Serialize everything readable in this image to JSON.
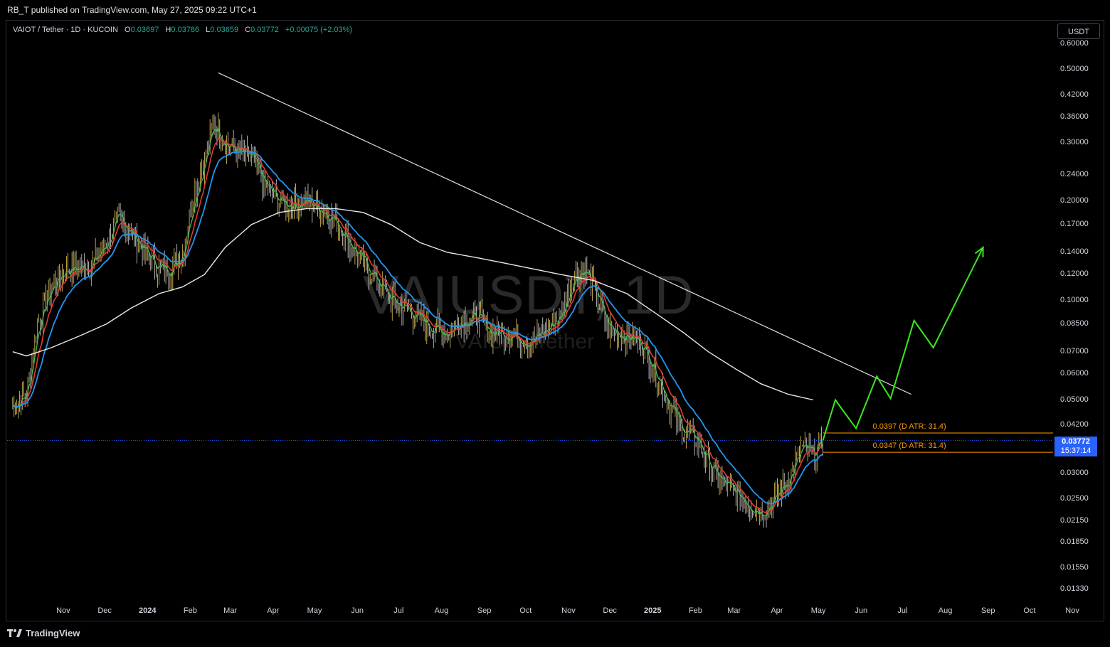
{
  "header": {
    "publish_text": "RB_T published on TradingView.com, May 27, 2025 09:22 UTC+1"
  },
  "legend": {
    "symbol": "VAIOT / Tether · 1D · KUCOIN",
    "o_label": "O",
    "o_value": "0.03697",
    "h_label": "H",
    "h_value": "0.03786",
    "l_label": "L",
    "l_value": "0.03659",
    "c_label": "C",
    "c_value": "0.03772",
    "change": "+0.00075 (+2.03%)"
  },
  "currency_button": "USDT",
  "watermark": {
    "main": "VAIUSDT, 1D",
    "sub": "VAIOT / Tether"
  },
  "price_tag": {
    "price": "0.03772",
    "countdown": "15:37:14"
  },
  "atr_levels": [
    {
      "text": "0.0397 (D ATR: 31.4)",
      "price": 0.0397
    },
    {
      "text": "0.0347 (D ATR: 31.4)",
      "price": 0.0347
    }
  ],
  "footer": {
    "brand": "TradingView"
  },
  "colors": {
    "ema_fast": "#4caf50",
    "ema_mid": "#e53935",
    "ema_slow": "#2196f3",
    "ma_long": "#e8e8e8",
    "projection": "#39e81c",
    "trendline": "#e0e0e0",
    "price_tag": "#2962ff",
    "atr": "#ff9800"
  },
  "chart_data": {
    "type": "line",
    "title": "VAIUSDT, 1D",
    "scale": "log",
    "ylim": [
      0.0125,
      0.62
    ],
    "y_ticks": [
      "0.60000",
      "0.50000",
      "0.42000",
      "0.36000",
      "0.30000",
      "0.24000",
      "0.20000",
      "0.17000",
      "0.14000",
      "0.12000",
      "0.10000",
      "0.08500",
      "0.07000",
      "0.06000",
      "0.05000",
      "0.04200",
      "0.03000",
      "0.02500",
      "0.02150",
      "0.01850",
      "0.01550",
      "0.01330"
    ],
    "x_ticks": [
      {
        "label": "Nov",
        "bold": false
      },
      {
        "label": "Dec",
        "bold": false
      },
      {
        "label": "2024",
        "bold": true
      },
      {
        "label": "Feb",
        "bold": false
      },
      {
        "label": "Mar",
        "bold": false
      },
      {
        "label": "Apr",
        "bold": false
      },
      {
        "label": "May",
        "bold": false
      },
      {
        "label": "Jun",
        "bold": false
      },
      {
        "label": "Jul",
        "bold": false
      },
      {
        "label": "Aug",
        "bold": false
      },
      {
        "label": "Sep",
        "bold": false
      },
      {
        "label": "Oct",
        "bold": false
      },
      {
        "label": "Nov",
        "bold": false
      },
      {
        "label": "Dec",
        "bold": false
      },
      {
        "label": "2025",
        "bold": true
      },
      {
        "label": "Feb",
        "bold": false
      },
      {
        "label": "Mar",
        "bold": false
      },
      {
        "label": "Apr",
        "bold": false
      },
      {
        "label": "May",
        "bold": false
      },
      {
        "label": "Jun",
        "bold": false
      },
      {
        "label": "Jul",
        "bold": false
      },
      {
        "label": "Aug",
        "bold": false
      },
      {
        "label": "Sep",
        "bold": false
      },
      {
        "label": "Oct",
        "bold": false
      },
      {
        "label": "Nov",
        "bold": false
      }
    ],
    "price_path": [
      [
        "2023-10-18",
        0.048
      ],
      [
        "2023-10-28",
        0.052
      ],
      [
        "2023-11-05",
        0.085
      ],
      [
        "2023-11-15",
        0.11
      ],
      [
        "2023-11-25",
        0.125
      ],
      [
        "2023-12-05",
        0.125
      ],
      [
        "2023-12-15",
        0.13
      ],
      [
        "2023-12-25",
        0.15
      ],
      [
        "2024-01-03",
        0.18
      ],
      [
        "2024-01-12",
        0.16
      ],
      [
        "2024-01-22",
        0.14
      ],
      [
        "2024-02-01",
        0.125
      ],
      [
        "2024-02-10",
        0.125
      ],
      [
        "2024-02-18",
        0.14
      ],
      [
        "2024-02-25",
        0.2
      ],
      [
        "2024-03-05",
        0.27
      ],
      [
        "2024-03-12",
        0.35
      ],
      [
        "2024-03-20",
        0.3
      ],
      [
        "2024-03-30",
        0.28
      ],
      [
        "2024-04-08",
        0.27
      ],
      [
        "2024-04-18",
        0.22
      ],
      [
        "2024-04-28",
        0.2
      ],
      [
        "2024-05-08",
        0.195
      ],
      [
        "2024-05-18",
        0.2
      ],
      [
        "2024-05-28",
        0.19
      ],
      [
        "2024-06-08",
        0.175
      ],
      [
        "2024-06-18",
        0.15
      ],
      [
        "2024-06-28",
        0.13
      ],
      [
        "2024-07-08",
        0.115
      ],
      [
        "2024-07-18",
        0.1
      ],
      [
        "2024-07-28",
        0.095
      ],
      [
        "2024-08-08",
        0.088
      ],
      [
        "2024-08-18",
        0.082
      ],
      [
        "2024-08-28",
        0.08
      ],
      [
        "2024-09-08",
        0.088
      ],
      [
        "2024-09-18",
        0.09
      ],
      [
        "2024-09-28",
        0.08
      ],
      [
        "2024-10-08",
        0.08
      ],
      [
        "2024-10-18",
        0.078
      ],
      [
        "2024-10-28",
        0.075
      ],
      [
        "2024-11-08",
        0.082
      ],
      [
        "2024-11-18",
        0.09
      ],
      [
        "2024-11-28",
        0.12
      ],
      [
        "2024-12-05",
        0.125
      ],
      [
        "2024-12-12",
        0.11
      ],
      [
        "2024-12-22",
        0.082
      ],
      [
        "2025-01-05",
        0.078
      ],
      [
        "2025-01-15",
        0.075
      ],
      [
        "2025-01-25",
        0.062
      ],
      [
        "2025-02-05",
        0.048
      ],
      [
        "2025-02-15",
        0.04
      ],
      [
        "2025-02-25",
        0.038
      ],
      [
        "2025-03-05",
        0.032
      ],
      [
        "2025-03-15",
        0.028
      ],
      [
        "2025-03-25",
        0.026
      ],
      [
        "2025-04-05",
        0.024
      ],
      [
        "2025-04-12",
        0.023
      ],
      [
        "2025-04-22",
        0.025
      ],
      [
        "2025-05-02",
        0.029
      ],
      [
        "2025-05-12",
        0.036
      ],
      [
        "2025-05-20",
        0.034
      ],
      [
        "2025-05-27",
        0.0377
      ]
    ],
    "ma_long": [
      [
        "2023-10-18",
        0.07
      ],
      [
        "2023-10-28",
        0.068
      ],
      [
        "2023-11-15",
        0.072
      ],
      [
        "2023-12-05",
        0.078
      ],
      [
        "2023-12-25",
        0.085
      ],
      [
        "2024-01-12",
        0.095
      ],
      [
        "2024-02-01",
        0.105
      ],
      [
        "2024-02-18",
        0.11
      ],
      [
        "2024-03-05",
        0.12
      ],
      [
        "2024-03-20",
        0.145
      ],
      [
        "2024-04-08",
        0.17
      ],
      [
        "2024-04-28",
        0.185
      ],
      [
        "2024-05-18",
        0.19
      ],
      [
        "2024-06-08",
        0.19
      ],
      [
        "2024-06-28",
        0.185
      ],
      [
        "2024-07-18",
        0.17
      ],
      [
        "2024-08-08",
        0.15
      ],
      [
        "2024-08-28",
        0.14
      ],
      [
        "2024-09-18",
        0.135
      ],
      [
        "2024-10-08",
        0.13
      ],
      [
        "2024-10-28",
        0.125
      ],
      [
        "2024-11-18",
        0.12
      ],
      [
        "2024-12-12",
        0.115
      ],
      [
        "2025-01-05",
        0.105
      ],
      [
        "2025-01-25",
        0.092
      ],
      [
        "2025-02-15",
        0.08
      ],
      [
        "2025-03-05",
        0.07
      ],
      [
        "2025-03-25",
        0.062
      ],
      [
        "2025-04-12",
        0.056
      ],
      [
        "2025-05-02",
        0.052
      ],
      [
        "2025-05-20",
        0.05
      ]
    ],
    "projection_path": [
      [
        "2025-05-27",
        0.0377
      ],
      [
        "2025-06-05",
        0.05
      ],
      [
        "2025-06-20",
        0.041
      ],
      [
        "2025-07-05",
        0.059
      ],
      [
        "2025-07-15",
        0.0505
      ],
      [
        "2025-08-01",
        0.087
      ],
      [
        "2025-08-15",
        0.072
      ],
      [
        "2025-09-20",
        0.145
      ]
    ],
    "trendline": [
      [
        "2024-03-15",
        0.49
      ],
      [
        "2025-07-30",
        0.052
      ]
    ],
    "last_price": 0.03772
  }
}
